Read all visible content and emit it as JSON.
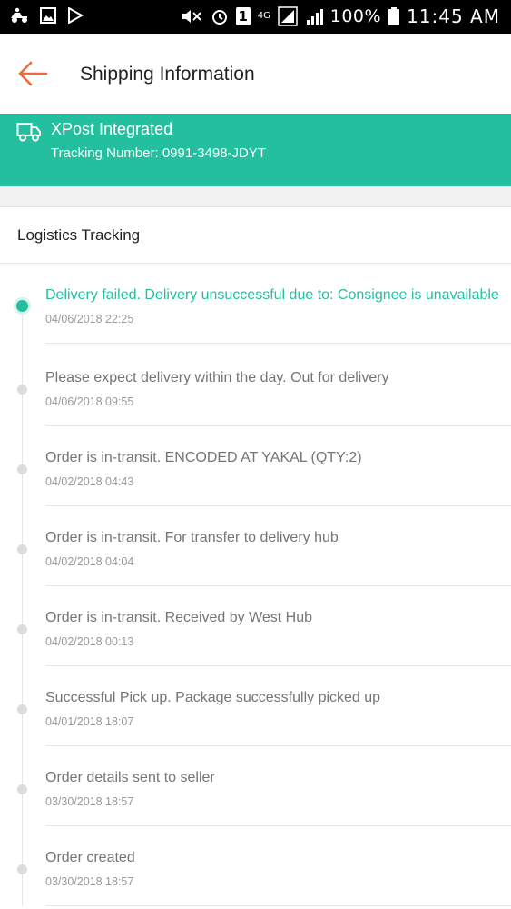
{
  "status_bar": {
    "battery_percent": "100%",
    "time": "11:45 AM",
    "network": "4G",
    "sim_slot": "1"
  },
  "header": {
    "title": "Shipping Information",
    "back_icon": "arrow-left-icon",
    "accent_color": "#ea6a3a"
  },
  "carrier": {
    "name": "XPost Integrated",
    "tracking_label": "Tracking Number:",
    "tracking_number": "0991-3498-JDYT",
    "banner_color": "#23bf9f",
    "icon": "truck-icon"
  },
  "tracking": {
    "section_title": "Logistics Tracking",
    "events": [
      {
        "text": "Delivery failed. Delivery unsuccessful due to: Consignee is unavailable",
        "time": "04/06/2018 22:25",
        "active": true
      },
      {
        "text": "Please expect delivery within the day. Out for delivery",
        "time": "04/06/2018 09:55",
        "active": false
      },
      {
        "text": "Order is in-transit. ENCODED AT YAKAL (QTY:2)",
        "time": "04/02/2018 04:43",
        "active": false
      },
      {
        "text": "Order is in-transit. For transfer to delivery hub",
        "time": "04/02/2018 04:04",
        "active": false
      },
      {
        "text": "Order is in-transit. Received by West Hub",
        "time": "04/02/2018 00:13",
        "active": false
      },
      {
        "text": "Successful Pick up. Package successfully picked up",
        "time": "04/01/2018 18:07",
        "active": false
      },
      {
        "text": "Order details sent to seller",
        "time": "03/30/2018 18:57",
        "active": false
      },
      {
        "text": "Order created",
        "time": "03/30/2018 18:57",
        "active": false
      }
    ]
  }
}
